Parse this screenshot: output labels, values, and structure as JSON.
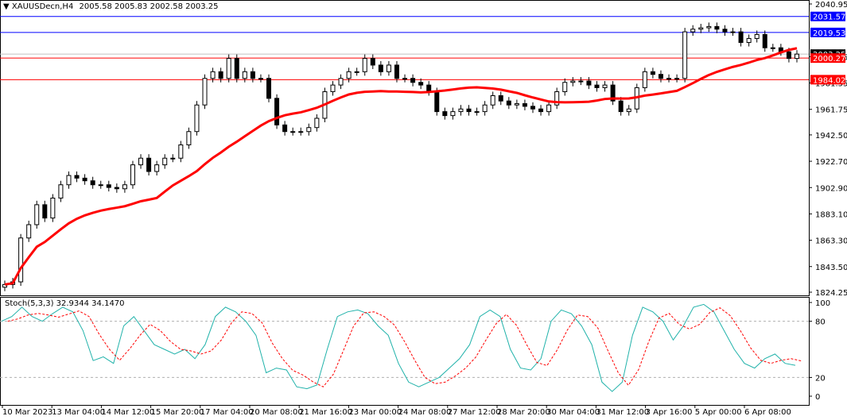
{
  "header": {
    "symbol": "XAUUSDecn,H4",
    "ohlc": "2005.58 2005.83 2002.58 2003.25"
  },
  "indicator": {
    "label": "Stoch(5,3,3) 32.9344 34.1470"
  },
  "colors": {
    "bull": "#ffffff",
    "bear": "#000000",
    "ma": "#ff0000",
    "stoch_main": "#20b2aa",
    "stoch_signal": "#ff0000",
    "blue_line": "#0000ff",
    "red_line": "#ff0000"
  },
  "chart_data": {
    "type": "candlestick",
    "price_axis": {
      "range": [
        1824.25,
        2040.95
      ],
      "ticks": [
        "2040.95",
        "2001.35",
        "1981.55",
        "1961.75",
        "1942.50",
        "1922.70",
        "1902.90",
        "1883.10",
        "1863.30",
        "1843.50",
        "1824.25"
      ]
    },
    "time_axis": {
      "ticks": [
        "10 Mar 2023",
        "13 Mar 04:00",
        "14 Mar 12:00",
        "15 Mar 20:00",
        "17 Mar 04:00",
        "20 Mar 08:00",
        "21 Mar 16:00",
        "23 Mar 00:00",
        "24 Mar 08:00",
        "27 Mar 12:00",
        "28 Mar 20:00",
        "30 Mar 04:00",
        "31 Mar 12:00",
        "3 Apr 16:00",
        "5 Apr 00:00",
        "6 Apr 08:00"
      ]
    },
    "levels": [
      {
        "price": 2031.57,
        "label": "2031.57",
        "color": "blue"
      },
      {
        "price": 2019.53,
        "label": "2019.53",
        "color": "blue"
      },
      {
        "price": 2003.25,
        "label": "2003.25",
        "color": "black"
      },
      {
        "price": 2000.27,
        "label": "2000.27",
        "color": "red"
      },
      {
        "price": 1984.02,
        "label": "1984.02",
        "color": "red"
      }
    ],
    "close": [
      1830,
      1832,
      1865,
      1875,
      1890,
      1880,
      1895,
      1905,
      1912,
      1910,
      1908,
      1905,
      1905,
      1903,
      1902,
      1905,
      1920,
      1925,
      1915,
      1920,
      1925,
      1925,
      1935,
      1945,
      1965,
      1985,
      1990,
      1985,
      2000,
      1985,
      1990,
      1985,
      1985,
      1970,
      1950,
      1945,
      1945,
      1945,
      1948,
      1955,
      1975,
      1980,
      1985,
      1990,
      1990,
      2000,
      1995,
      1990,
      1995,
      1985,
      1985,
      1982,
      1980,
      1975,
      1960,
      1957,
      1960,
      1962,
      1960,
      1960,
      1965,
      1972,
      1968,
      1965,
      1966,
      1964,
      1962,
      1960,
      1965,
      1975,
      1982,
      1983,
      1983,
      1980,
      1978,
      1980,
      1968,
      1960,
      1962,
      1978,
      1990,
      1988,
      1985,
      1985,
      1985,
      2020,
      2022,
      2023,
      2024,
      2022,
      2020,
      2020,
      2012,
      2015,
      2018,
      2008,
      2008,
      2005,
      2000,
      2003.25
    ],
    "ma_period": 20,
    "stochastic": {
      "params": "5,3,3",
      "levels": [
        20,
        80
      ],
      "axis_ticks": [
        "100",
        "80",
        "20",
        "0"
      ],
      "k": [
        80,
        85,
        95,
        85,
        80,
        88,
        95,
        90,
        70,
        38,
        42,
        35,
        75,
        85,
        70,
        55,
        50,
        45,
        50,
        40,
        55,
        85,
        95,
        90,
        80,
        65,
        25,
        30,
        28,
        10,
        8,
        12,
        50,
        85,
        90,
        92,
        88,
        75,
        65,
        35,
        15,
        10,
        15,
        20,
        30,
        40,
        55,
        85,
        92,
        85,
        50,
        30,
        28,
        40,
        80,
        92,
        88,
        75,
        55,
        15,
        5,
        15,
        65,
        95,
        90,
        80,
        60,
        75,
        95,
        98,
        90,
        70,
        50,
        35,
        30,
        40,
        45,
        35,
        32.93
      ]
    }
  }
}
